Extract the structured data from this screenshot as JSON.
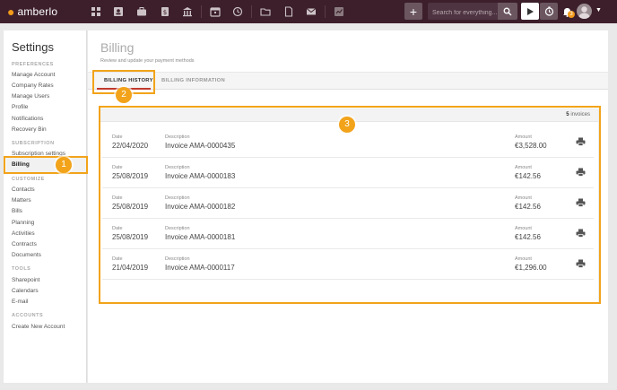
{
  "app": {
    "logo_text": "amberlo"
  },
  "topbar": {
    "nav_icons": [
      "dashboard-icon",
      "contacts-icon",
      "matters-icon",
      "bills-icon",
      "institution-icon",
      "calendar-icon",
      "history-icon",
      "folder-icon",
      "documents-icon",
      "mail-icon",
      "reports-icon"
    ],
    "plus_label": "+",
    "search_placeholder": "Search for everything...",
    "notification_count": "3"
  },
  "sidebar": {
    "title": "Settings",
    "sections": [
      {
        "label": "PREFERENCES",
        "items": [
          "Manage Account",
          "Company Rates",
          "Manage Users",
          "Profile",
          "Notifications",
          "Recovery Bin"
        ]
      },
      {
        "label": "SUBSCRIPTION",
        "items": [
          "Subscription settings",
          "Billing"
        ]
      },
      {
        "label": "CUSTOMIZE",
        "items": [
          "Contacts",
          "Matters",
          "Bills",
          "Planning",
          "Activities",
          "Contracts",
          "Documents"
        ]
      },
      {
        "label": "TOOLS",
        "items": [
          "Sharepoint",
          "Calendars",
          "E-mail"
        ]
      },
      {
        "label": "ACCOUNTS",
        "items": [
          "Create New Account"
        ]
      }
    ],
    "active_item": "Billing"
  },
  "main": {
    "title": "Billing",
    "subtitle": "Review and update your payment methods",
    "tabs": [
      {
        "label": "BILLING HISTORY",
        "active": true
      },
      {
        "label": "BILLING INFORMATION",
        "active": false
      }
    ],
    "invoice_count": "5",
    "invoice_count_suffix": "invoices",
    "columns": {
      "date": "Date",
      "description": "Description",
      "amount": "Amount"
    },
    "invoices": [
      {
        "date": "22/04/2020",
        "description": "Invoice AMA-0000435",
        "amount": "€3,528.00"
      },
      {
        "date": "25/08/2019",
        "description": "Invoice AMA-0000183",
        "amount": "€142.56"
      },
      {
        "date": "25/08/2019",
        "description": "Invoice AMA-0000182",
        "amount": "€142.56"
      },
      {
        "date": "25/08/2019",
        "description": "Invoice AMA-0000181",
        "amount": "€142.56"
      },
      {
        "date": "21/04/2019",
        "description": "Invoice AMA-0000117",
        "amount": "€1,296.00"
      }
    ]
  },
  "annotations": [
    "1",
    "2",
    "3"
  ],
  "colors": {
    "topbar": "#3c1f2b",
    "accent": "#f2a31a",
    "active_tab": "#c0392b"
  }
}
